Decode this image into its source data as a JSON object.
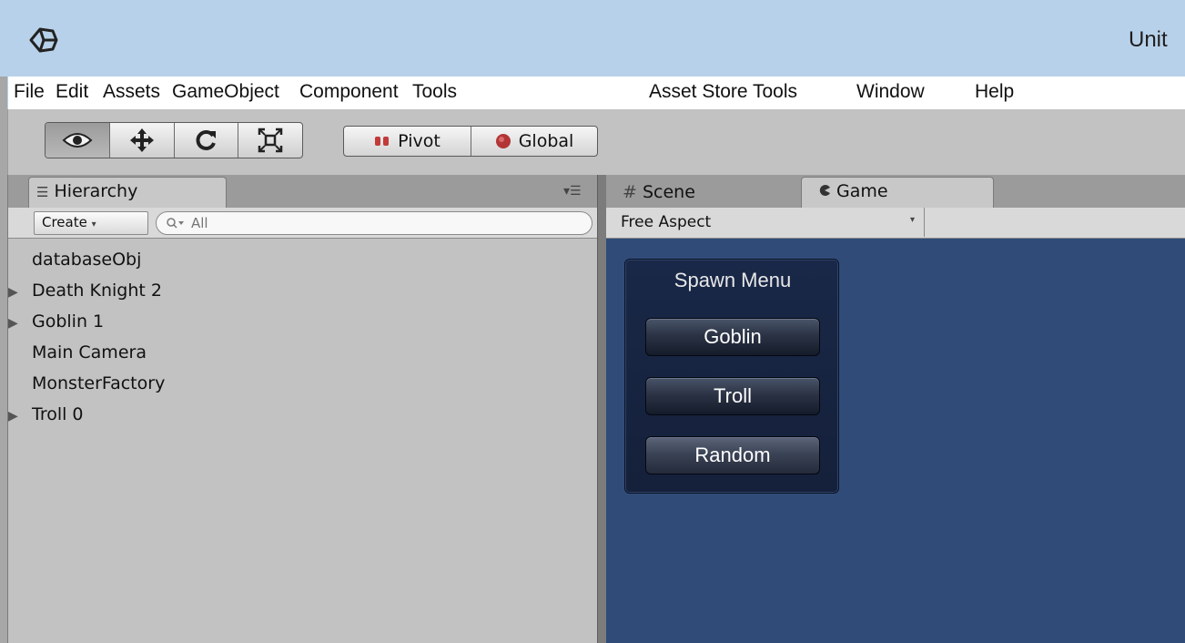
{
  "window": {
    "title": "Unit"
  },
  "menubar": {
    "items": [
      "File",
      "Edit",
      "Assets",
      "GameObject",
      "Component",
      "Tools",
      "Asset Store Tools",
      "Window",
      "Help"
    ]
  },
  "toolbar": {
    "tools": [
      "view-tool",
      "move-tool",
      "rotate-tool",
      "scale-tool"
    ],
    "active_tool": "view-tool",
    "pivot_label": "Pivot",
    "global_label": "Global"
  },
  "hierarchy": {
    "tab_label": "Hierarchy",
    "create_label": "Create",
    "search_placeholder": "All",
    "items": [
      {
        "label": "databaseObj",
        "expandable": false
      },
      {
        "label": "Death Knight 2",
        "expandable": true
      },
      {
        "label": "Goblin 1",
        "expandable": true
      },
      {
        "label": "Main Camera",
        "expandable": false
      },
      {
        "label": "MonsterFactory",
        "expandable": false
      },
      {
        "label": "Troll 0",
        "expandable": true
      }
    ]
  },
  "views": {
    "scene_tab": "Scene",
    "game_tab": "Game",
    "active_tab": "Game",
    "aspect_label": "Free Aspect"
  },
  "game": {
    "background": "#304b78",
    "spawn_menu": {
      "title": "Spawn Menu",
      "buttons": [
        "Goblin",
        "Troll",
        "Random"
      ]
    }
  }
}
